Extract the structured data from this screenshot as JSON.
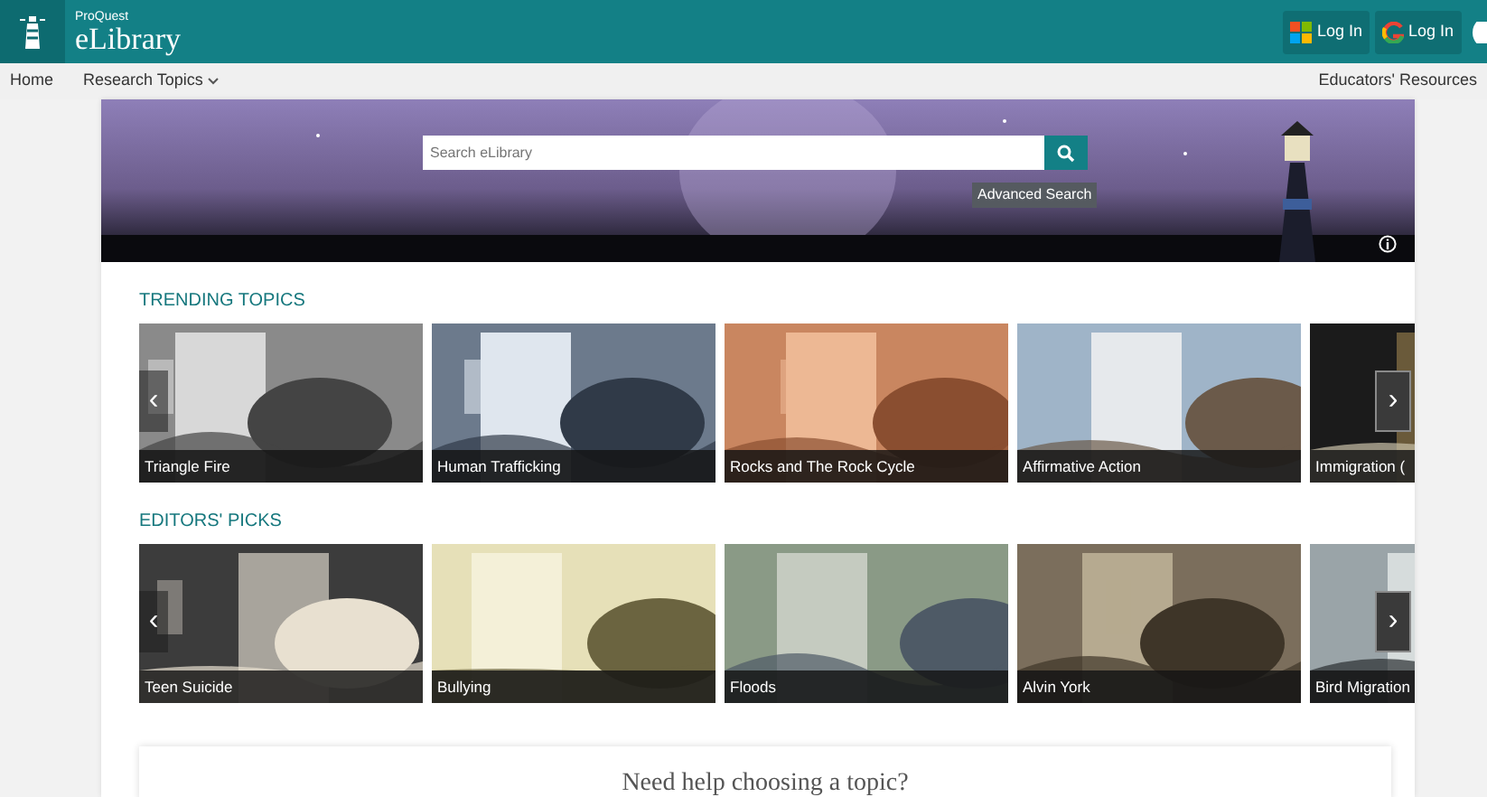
{
  "header": {
    "brand_small": "ProQuest",
    "brand": "eLibrary",
    "login_buttons": [
      {
        "kind": "microsoft",
        "label": "Log In"
      },
      {
        "kind": "google",
        "label": "Log In"
      }
    ]
  },
  "nav": {
    "items": [
      {
        "label": "Home",
        "dropdown": false
      },
      {
        "label": "Research Topics",
        "dropdown": true
      }
    ],
    "right_link": "Educators' Resources"
  },
  "hero": {
    "search": {
      "placeholder": "Search eLibrary"
    },
    "advanced_search": "Advanced Search"
  },
  "sections": [
    {
      "title": "TRENDING TOPICS",
      "prev": "‹",
      "next": "›",
      "cards": [
        {
          "label": "Triangle Fire"
        },
        {
          "label": "Human Trafficking"
        },
        {
          "label": "Rocks and The Rock Cycle"
        },
        {
          "label": "Affirmative Action"
        },
        {
          "label": "Immigration ("
        }
      ]
    },
    {
      "title": "EDITORS' PICKS",
      "prev": "‹",
      "next": "›",
      "cards": [
        {
          "label": "Teen Suicide"
        },
        {
          "label": "Bullying"
        },
        {
          "label": "Floods"
        },
        {
          "label": "Alvin York"
        },
        {
          "label": "Bird Migration"
        }
      ]
    }
  ],
  "help_card": {
    "title": "Need help choosing a topic?"
  }
}
